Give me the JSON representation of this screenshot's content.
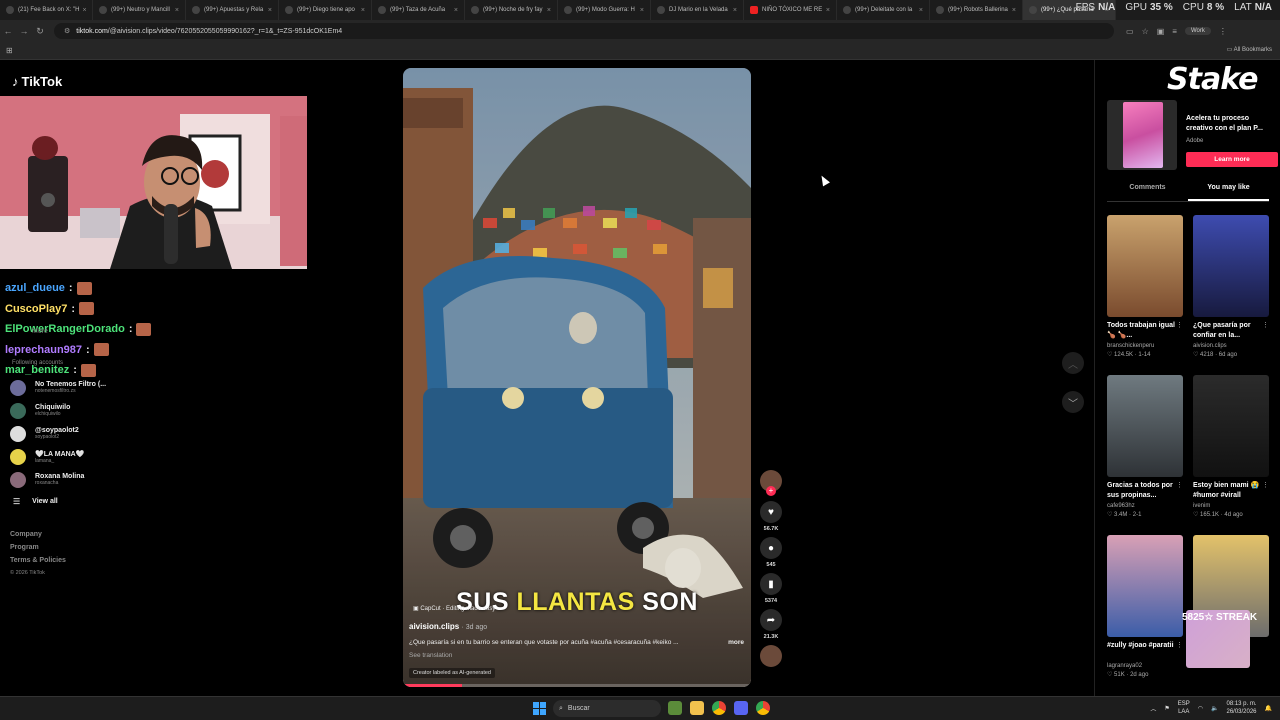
{
  "browser": {
    "tabs": [
      {
        "label": "(21) Fee Back on X: \"H",
        "type": "x"
      },
      {
        "label": "(99+) Neutro y Mancill",
        "type": "tiktok"
      },
      {
        "label": "(99+) Apuestas y Rela",
        "type": "tiktok"
      },
      {
        "label": "(99+) Diego tiene apo",
        "type": "tiktok"
      },
      {
        "label": "(99+) Taza de Acuña",
        "type": "tiktok"
      },
      {
        "label": "(99+) Noche de fry fay",
        "type": "tiktok"
      },
      {
        "label": "(99+) Modo Guerra: H",
        "type": "tiktok"
      },
      {
        "label": "DJ Mario en la Velada",
        "type": "tiktok"
      },
      {
        "label": "NIÑO TÓXICO ME RE",
        "type": "youtube"
      },
      {
        "label": "(99+) Deleitate con la",
        "type": "tiktok"
      },
      {
        "label": "(99+) Robots Ballerina",
        "type": "tiktok"
      },
      {
        "label": "(99+) ¿Qué pasaría",
        "type": "tiktok"
      }
    ],
    "url_domain": "tiktok.com",
    "url_path": "/@aivision.clips/video/7620552055059990162?_r=1&_t=ZS-951dcOK1Em4",
    "profile_label": "Work",
    "all_bookmarks": "All Bookmarks"
  },
  "overlay_stats": [
    {
      "key": "FPS",
      "value": "N/A"
    },
    {
      "key": "GPU",
      "value": "35 %"
    },
    {
      "key": "CPU",
      "value": "8 %"
    },
    {
      "key": "LAT",
      "value": "N/A"
    }
  ],
  "tiktok": {
    "logo": "TikTok",
    "following_title": "Following accounts",
    "more_label": "More",
    "following": [
      {
        "name": "No Tenemos Filtro (...",
        "handle": "notenemosfiltro.zs"
      },
      {
        "name": "Chiquiwilo",
        "handle": "elchiquiwilo"
      },
      {
        "name": "@soypaolot2",
        "handle": "soypaolot2"
      },
      {
        "name": "🤍LA MANA🤍",
        "handle": "lamana_"
      },
      {
        "name": "Roxana Molina",
        "handle": "roxanacha"
      }
    ],
    "view_all": "View all",
    "footer": [
      "Company",
      "Program",
      "Terms & Policies"
    ],
    "copyright": "© 2026 TikTok"
  },
  "stream_chat": [
    {
      "user": "azul_dueue",
      "sep": ":",
      "color": "blue"
    },
    {
      "user": "CuscoPlay7",
      "sep": ":",
      "color": "yellow"
    },
    {
      "user": "ElPowerRangerDorado",
      "sep": ":",
      "color": "green"
    },
    {
      "user": "leprechaun987",
      "sep": ":",
      "color": "purple"
    },
    {
      "user": "mar_benitez",
      "sep": ":",
      "color": "green"
    }
  ],
  "video": {
    "caption_white1": "SUS",
    "caption_yellow": "LLANTAS",
    "caption_white2": "SON",
    "capcut": "CapCut · Editing made easy",
    "author": "aivision.clips",
    "ago": "· 3d ago",
    "description": "¿Que pasaría si  en tu barrio  se enteran que votaste por  acuña #acuña #cesaracuña #keiko ...",
    "more": "more",
    "see_translation": "See translation",
    "ai_label": "Creator labeled as AI-generated",
    "progress_fraction": 0.17
  },
  "actions": {
    "likes": "56.7K",
    "comments": "545",
    "saves": "5374",
    "shares": "21.3K"
  },
  "ad": {
    "text": "Acelera tu proceso creativo con el plan P...",
    "brand": "Adobe",
    "cta": "Learn more",
    "overlay_logo": "Stake"
  },
  "right_tabs": {
    "comments": "Comments",
    "you_may_like": "You may like"
  },
  "suggestions": [
    {
      "title": "Todos trabajan igual 🍗 🍗...",
      "author": "branschickenperu",
      "likes": "124.5K",
      "date": "1-14"
    },
    {
      "title": "¿Que pasaría por confiar en la...",
      "author": "aivision.clips",
      "likes": "4218",
      "date": "6d ago"
    },
    {
      "title": "Gracias a todos por sus propinas...",
      "author": "cafe963hz",
      "likes": "3.4M",
      "date": "2-1"
    },
    {
      "title": "Estoy bien mami 😭#humor #virall",
      "author": "ivenim",
      "likes": "165.1K",
      "date": "4d ago"
    },
    {
      "title": "#zully #joao #paratii",
      "author": "lagranraya02",
      "likes": "51K",
      "date": "2d ago"
    },
    {
      "title": "#_",
      "author": "",
      "likes": "",
      "date": ""
    }
  ],
  "streak": "5825☆ STREAK",
  "taskbar": {
    "search": "Buscar",
    "lang_top": "ESP",
    "lang_bottom": "LAA",
    "time": "08:13 p. m.",
    "date": "26/03/2026"
  }
}
